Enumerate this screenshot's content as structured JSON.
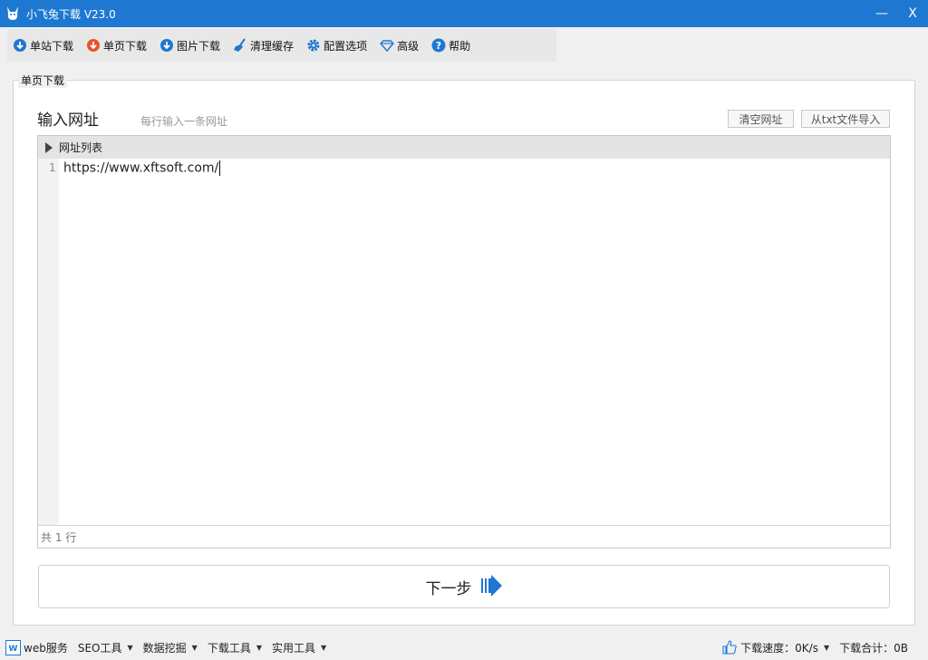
{
  "window": {
    "title": "小飞兔下载 V23.0",
    "minimize_label": "—",
    "close_label": "X"
  },
  "toolbar": {
    "items": [
      {
        "label": "单站下载",
        "icon": "cloud-download-icon",
        "color": "#1e78d2"
      },
      {
        "label": "单页下载",
        "icon": "cloud-download-icon",
        "color": "#e8552b"
      },
      {
        "label": "图片下载",
        "icon": "cloud-download-icon",
        "color": "#1e78d2"
      },
      {
        "label": "清理缓存",
        "icon": "broom-icon",
        "color": "#1e78d2"
      },
      {
        "label": "配置选项",
        "icon": "gear-icon",
        "color": "#1e78d2"
      },
      {
        "label": "高级",
        "icon": "diamond-icon",
        "color": "#1e78d2"
      },
      {
        "label": "帮助",
        "icon": "help-icon",
        "color": "#1e78d2"
      }
    ]
  },
  "group": {
    "legend": "单页下载"
  },
  "input_section": {
    "title": "输入网址",
    "hint": "每行输入一条网址",
    "clear_button": "清空网址",
    "import_button": "从txt文件导入"
  },
  "editor": {
    "header_label": "网址列表",
    "lines": [
      {
        "number": "1",
        "text": "https://www.xftsoft.com/"
      }
    ],
    "footer": "共 1 行"
  },
  "next_button": {
    "label": "下一步"
  },
  "statusbar": {
    "web_service": "web服务",
    "menus": [
      "SEO工具",
      "数据挖掘",
      "下载工具",
      "实用工具"
    ],
    "speed": "下载速度：0K/s",
    "total": "下载合计：0B"
  },
  "colors": {
    "accent": "#1e78d2",
    "accent_orange": "#e8552b"
  }
}
